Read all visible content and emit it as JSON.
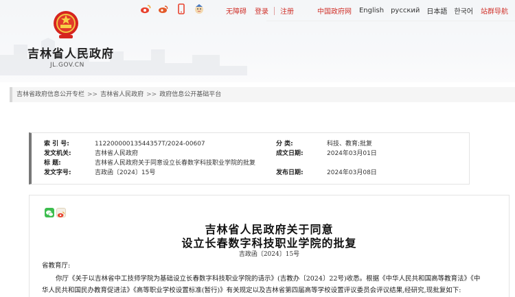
{
  "header": {
    "site_title": "吉林省人民政府",
    "site_domain": "JL.GOV.CN",
    "social_icons": [
      "weibo-icon",
      "weibo-alt-icon",
      "mobile-icon",
      "mascot-icon"
    ],
    "nav": {
      "accessibility": "无障碍",
      "login": "登录",
      "register": "注册",
      "china_gov": "中国政府网",
      "english": "English",
      "russian": "русский",
      "japanese": "日本語",
      "korean": "한국어",
      "site_nav": "站群导航"
    }
  },
  "breadcrumb": {
    "items": [
      "吉林省政府信息公开专栏",
      "吉林省人民政府",
      "政府信息公开基础平台"
    ],
    "separator": ">>"
  },
  "info": {
    "index_label": "索  引  号:",
    "index_value": "11220000013544357T/2024-00607",
    "category_label": "分    类:",
    "category_value": "科技、教育;批复",
    "issuer_label": "发文机关:",
    "issuer_value": "吉林省人民政府",
    "date_written_label": "成文日期:",
    "date_written_value": "2024年03月01日",
    "title_label": "标    题:",
    "title_value": "吉林省人民政府关于同意设立长春数字科技职业学院的批复",
    "doc_no_label": "发文字号:",
    "doc_no_value": "吉政函〔2024〕15号",
    "publish_label": "发布日期:",
    "publish_value": "2024年03月08日"
  },
  "article": {
    "title_line1": "吉林省人民政府关于同意",
    "title_line2": "设立长春数字科技职业学院的批复",
    "doc_number": "吉政函〔2024〕15号",
    "salutation": "省教育厅:",
    "para1": "你厅《关于以吉林省中工技师学院为基础设立长春数字科技职业学院的请示》(吉教办〔2024〕22号)收悉。根据《中华人民共和国高等教育法》《中",
    "para2": "华人民共和国民办教育促进法》《高等职业学校设置标准(暂行)》有关规定以及吉林省第四届高等学校设置评议委员会评议结果,经研究,现批复如下:"
  },
  "colors": {
    "accent_red": "#d0322b",
    "wechat_green": "#3dbd4f",
    "weibo_orange": "#f2a233"
  }
}
